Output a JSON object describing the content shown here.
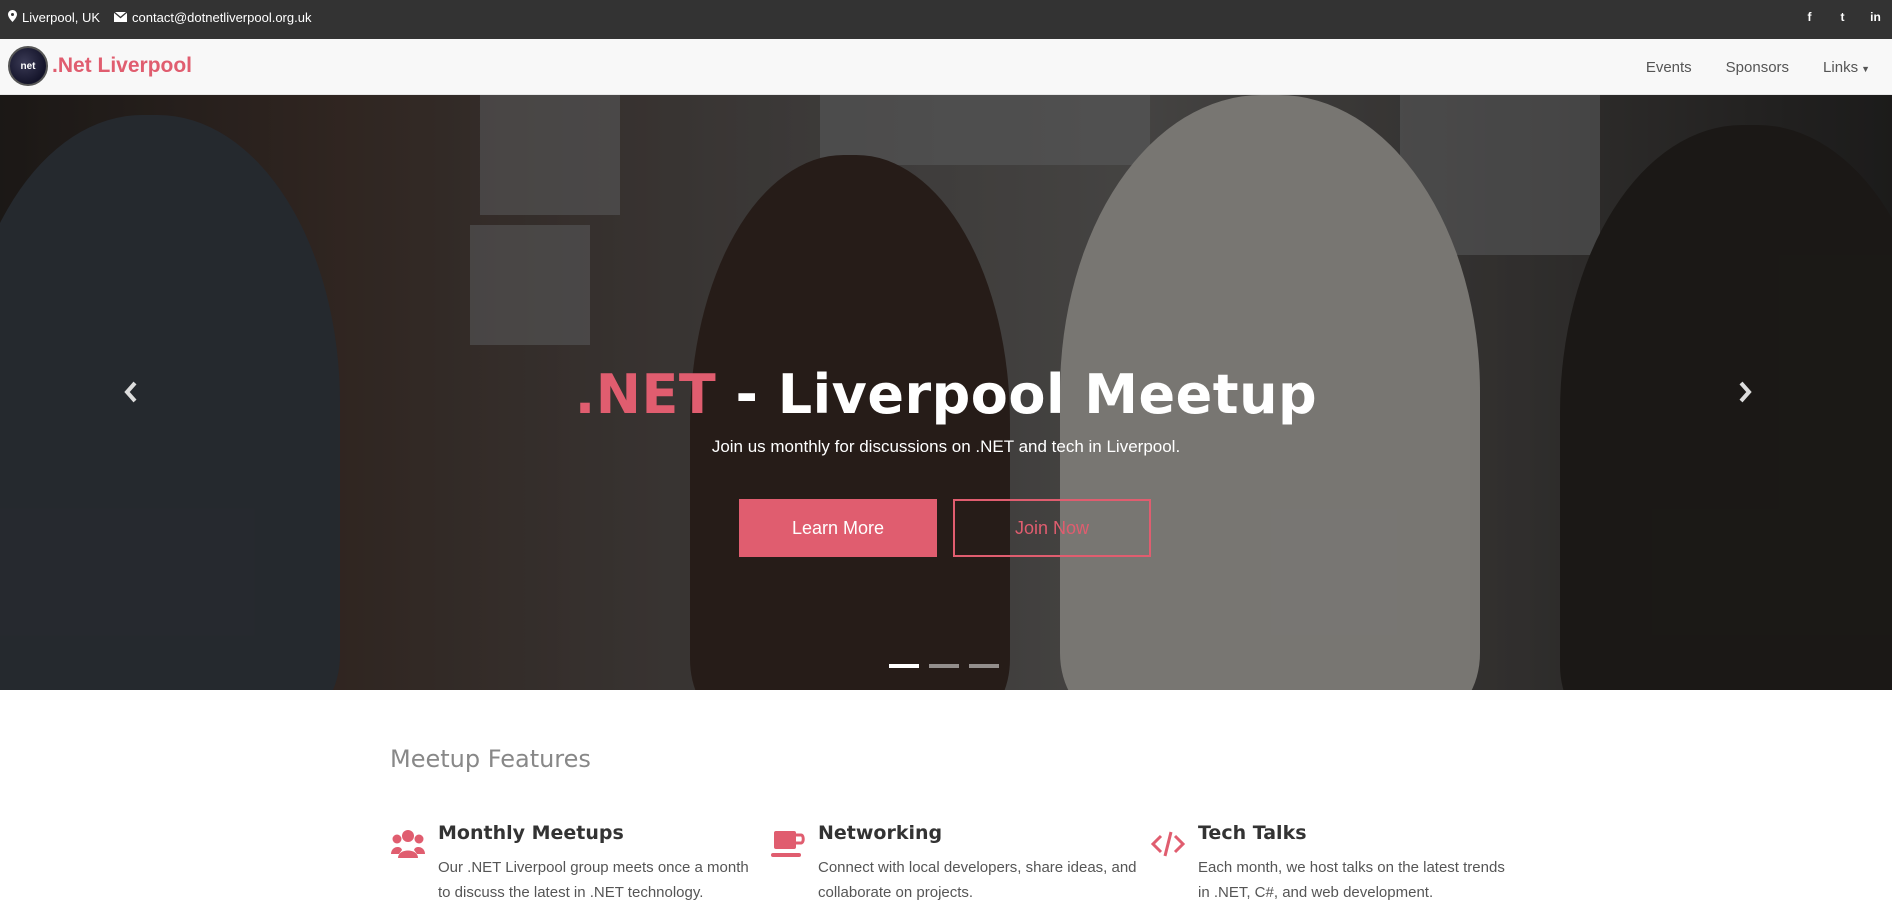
{
  "topbar": {
    "location": "Liverpool, UK",
    "email": "contact@dotnetliverpool.org.uk",
    "icons": [
      "map-marker-icon",
      "envelope-icon"
    ],
    "social": [
      {
        "icon": "facebook-icon",
        "glyph": "f"
      },
      {
        "icon": "twitter-icon",
        "glyph": "t"
      },
      {
        "icon": "linkedin-icon",
        "glyph": "in"
      }
    ]
  },
  "navbar": {
    "logo_text": "net",
    "brand": ".Net Liverpool",
    "links": [
      {
        "label": "Events"
      },
      {
        "label": "Sponsors"
      },
      {
        "label": "Links"
      }
    ]
  },
  "hero": {
    "title_accent": ".NET",
    "title_rest": " - Liverpool Meetup",
    "subtitle": "Join us monthly for discussions on .NET and tech in Liverpool.",
    "learn_more": "Learn More",
    "join_now": "Join Now",
    "prev_glyph": "‹",
    "next_glyph": "›",
    "slide_count": 3,
    "active_slide": 1
  },
  "features": {
    "title": "Meetup Features",
    "items": [
      {
        "icon": "users-icon",
        "title": "Monthly Meetups",
        "text": "Our .NET Liverpool group meets once a month to discuss the latest in .NET technology."
      },
      {
        "icon": "coffee-cup-icon",
        "title": "Networking",
        "text": "Connect with local developers, share ideas, and collaborate on projects."
      },
      {
        "icon": "code-icon",
        "title": "Tech Talks",
        "text": "Each month, we host talks on the latest trends in .NET, C#, and web development."
      }
    ]
  },
  "colors": {
    "accent": "#e05d6f",
    "topbar": "#333333",
    "navbar": "#f8f8f8"
  }
}
